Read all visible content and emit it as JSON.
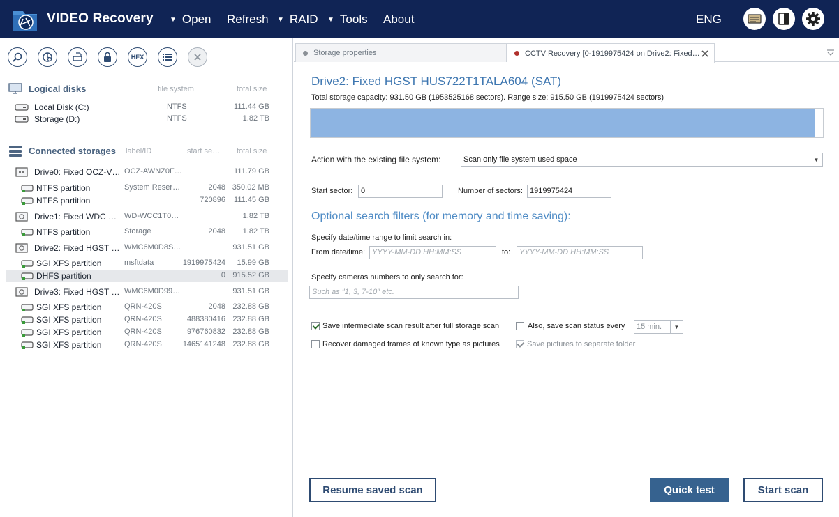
{
  "app": {
    "title": "VIDEO Recovery",
    "language": "ENG"
  },
  "menu": {
    "open": "Open",
    "refresh": "Refresh",
    "raid": "RAID",
    "tools": "Tools",
    "about": "About"
  },
  "left": {
    "logical_disks": {
      "title": "Logical disks",
      "col_fs": "file system",
      "col_size": "total size",
      "items": [
        {
          "name": "Local Disk (C:)",
          "fs": "NTFS",
          "size": "111.44 GB"
        },
        {
          "name": "Storage (D:)",
          "fs": "NTFS",
          "size": "1.82 TB"
        }
      ]
    },
    "connected": {
      "title": "Connected storages",
      "col_label": "label/ID",
      "col_start": "start se…",
      "col_size": "total size",
      "rows": [
        {
          "type": "drive-ssd",
          "name": "Drive0: Fixed OCZ-V…",
          "label": "OCZ-AWNZ0F…",
          "start": "",
          "size": "111.79 GB"
        },
        {
          "type": "partition",
          "name": "NTFS partition",
          "label": "System Reser…",
          "start": "2048",
          "size": "350.02 MB"
        },
        {
          "type": "partition",
          "name": "NTFS partition",
          "label": "",
          "start": "720896",
          "size": "111.45 GB"
        },
        {
          "type": "drive",
          "name": "Drive1: Fixed WDC …",
          "label": "WD-WCC1T0…",
          "start": "",
          "size": "1.82 TB"
        },
        {
          "type": "partition",
          "name": "NTFS partition",
          "label": "Storage",
          "start": "2048",
          "size": "1.82 TB"
        },
        {
          "type": "drive",
          "name": "Drive2: Fixed HGST …",
          "label": "WMC6M0D8S…",
          "start": "",
          "size": "931.51 GB"
        },
        {
          "type": "partition",
          "name": "SGI XFS partition",
          "label": "msftdata",
          "start": "1919975424",
          "size": "15.99 GB"
        },
        {
          "type": "partition",
          "name": "DHFS partition",
          "label": "",
          "start": "0",
          "size": "915.52 GB",
          "selected": true
        },
        {
          "type": "drive",
          "name": "Drive3: Fixed HGST …",
          "label": "WMC6M0D99…",
          "start": "",
          "size": "931.51 GB"
        },
        {
          "type": "partition",
          "name": "SGI XFS partition",
          "label": "QRN-420S",
          "start": "2048",
          "size": "232.88 GB"
        },
        {
          "type": "partition",
          "name": "SGI XFS partition",
          "label": "QRN-420S",
          "start": "488380416",
          "size": "232.88 GB"
        },
        {
          "type": "partition",
          "name": "SGI XFS partition",
          "label": "QRN-420S",
          "start": "976760832",
          "size": "232.88 GB"
        },
        {
          "type": "partition",
          "name": "SGI XFS partition",
          "label": "QRN-420S",
          "start": "1465141248",
          "size": "232.88 GB"
        }
      ]
    },
    "toolbar": {
      "hex_label": "HEX"
    }
  },
  "tabs": [
    {
      "label": "Storage properties",
      "dot_color": "#8a9096"
    },
    {
      "label": "CCTV Recovery [0-1919975424 on Drive2: Fixed…",
      "dot_color": "#b0302c"
    }
  ],
  "main": {
    "drive_title": "Drive2: Fixed HGST HUS722T1TALA604 (SAT)",
    "capacity_line": "Total storage capacity: 931.50 GB (1953525168 sectors). Range size: 915.50 GB (1919975424 sectors)",
    "range_fraction": 0.983,
    "action_label": "Action with the existing file system:",
    "action_value": "Scan only file system used space",
    "start_sector_label": "Start sector:",
    "start_sector_value": "0",
    "num_sectors_label": "Number of sectors:",
    "num_sectors_value": "1919975424",
    "filters_title": "Optional search filters (for memory and time saving):",
    "date_range_label": "Specify date/time range to limit search in:",
    "from_label": "From date/time:",
    "date_placeholder": "YYYY-MM-DD HH:MM:SS",
    "to_label": "to:",
    "cameras_label": "Specify cameras numbers to only search for:",
    "cameras_placeholder": "Such as \"1, 3, 7-10\" etc.",
    "opt_save_intermediate": "Save intermediate scan result after full storage scan",
    "opt_save_status": "Also, save scan status every",
    "interval_value": "15 min.",
    "opt_recover_damaged": "Recover damaged frames of known type as pictures",
    "opt_save_pictures": "Save pictures to separate folder",
    "btn_resume": "Resume saved scan",
    "btn_quick": "Quick test",
    "btn_start": "Start scan"
  },
  "colors": {
    "topbar": "#102455",
    "accent": "#36628f",
    "title_blue": "#3d76b0",
    "range_fill": "#8db4e2"
  }
}
